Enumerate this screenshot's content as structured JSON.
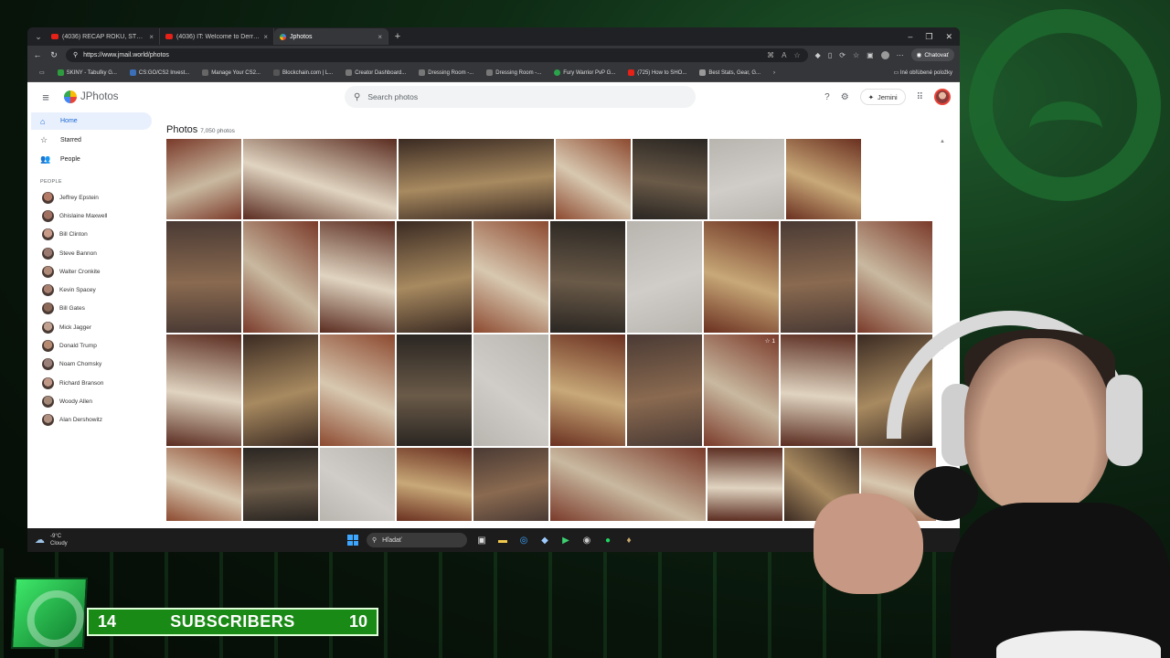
{
  "browser": {
    "tabs": [
      {
        "label": "(4036) RECAP ROKU, STREAMER S",
        "active": false
      },
      {
        "label": "(4036) IT: Welcome to Derry | Offic",
        "active": false
      },
      {
        "label": "Jphotos",
        "active": true
      }
    ],
    "url": "https://www.jmail.world/photos",
    "chat_label": "Chatovať",
    "bookmarks": [
      "SKINY - Tabuľky G...",
      "CS:GO/CS2 Invest...",
      "Manage Your CS2...",
      "Blockchain.com | L...",
      "Creator Dashboard...",
      "Dressing Room -...",
      "Dressing Room -...",
      "Fury Warrior PvP G...",
      "(725) How to SHO...",
      "Best Stats, Gear, G..."
    ],
    "bookmarks_other": "Iné obľúbené položky"
  },
  "app": {
    "name": "JPhotos",
    "search_placeholder": "Search photos",
    "assistant_label": "Jemini"
  },
  "sidebar": {
    "nav": [
      {
        "label": "Home",
        "icon": "home-icon",
        "active": true
      },
      {
        "label": "Starred",
        "icon": "star-icon",
        "active": false
      },
      {
        "label": "People",
        "icon": "people-icon",
        "active": false
      }
    ],
    "section_label": "PEOPLE",
    "people": [
      "Jeffrey Epstein",
      "Ghislaine Maxwell",
      "Bill Clinton",
      "Steve Bannon",
      "Walter Cronkite",
      "Kevin Spacey",
      "Bill Gates",
      "Mick Jagger",
      "Donald Trump",
      "Noam Chomsky",
      "Richard Branson",
      "Woody Allen",
      "Alan Dershowitz"
    ]
  },
  "main": {
    "title": "Photos",
    "count": "7,050 photos",
    "starred_badge": "1"
  },
  "taskbar": {
    "temperature": "-9°C",
    "condition": "Cloudy",
    "search_label": "Hľadať"
  },
  "overlay": {
    "subscribers_label": "SUBSCRIBERS",
    "left_value": "14",
    "right_value": "10"
  },
  "colors": {
    "accent_blue": "#1967d2",
    "active_nav_bg": "#e8f0fe",
    "subscriber_green": "#1a8a16"
  }
}
